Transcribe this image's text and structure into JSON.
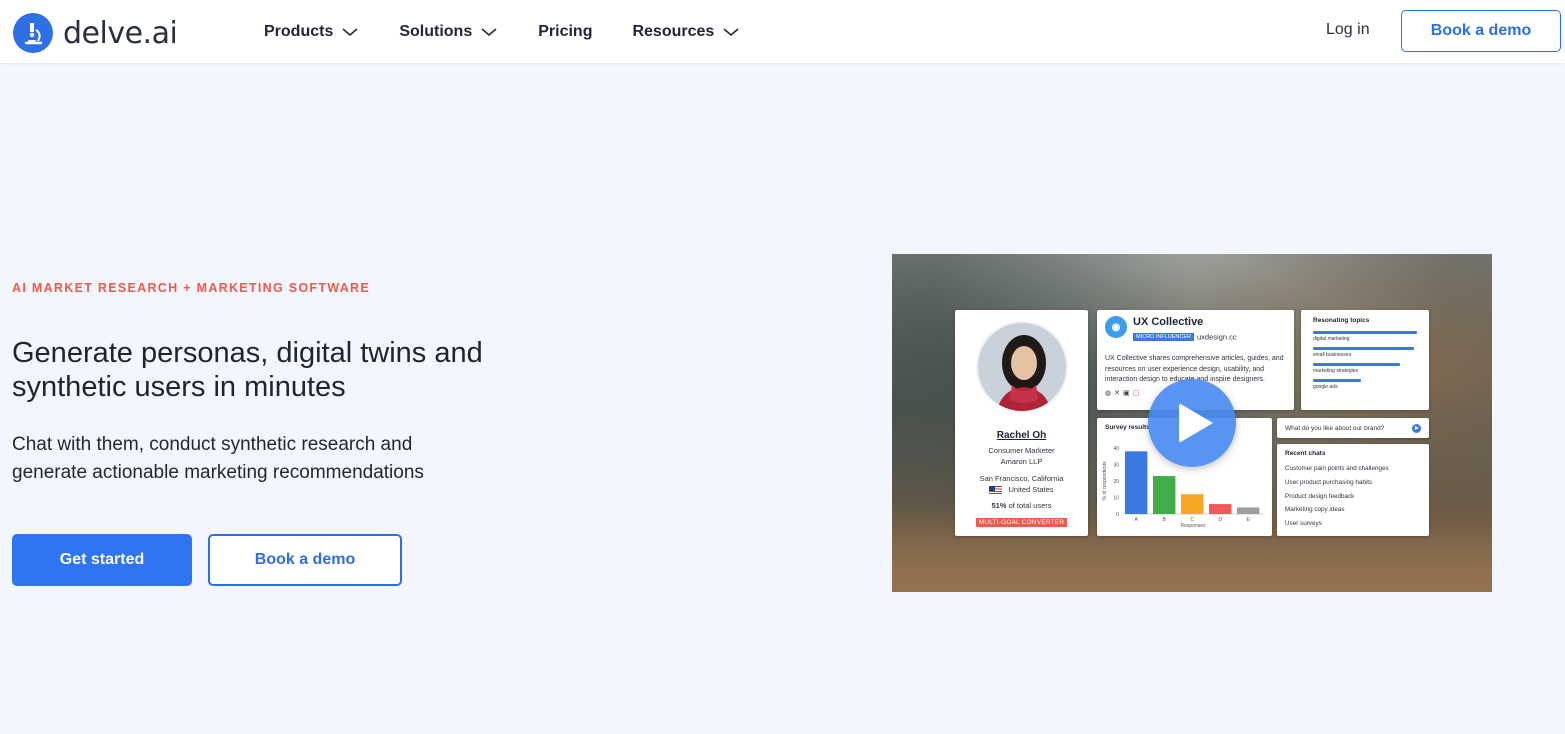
{
  "brand": {
    "name": "delve.ai"
  },
  "nav": {
    "items": [
      {
        "label": "Products",
        "has_dropdown": true
      },
      {
        "label": "Solutions",
        "has_dropdown": true
      },
      {
        "label": "Pricing",
        "has_dropdown": false
      },
      {
        "label": "Resources",
        "has_dropdown": true
      }
    ],
    "login": "Log in",
    "book_demo": "Book a demo"
  },
  "hero": {
    "eyebrow": "AI MARKET RESEARCH + MARKETING SOFTWARE",
    "headline": "Generate personas, digital twins and synthetic users in minutes",
    "subheadline": "Chat with them, conduct synthetic research and generate actionable marketing recommendations",
    "primary_cta": "Get started",
    "secondary_cta": "Book a demo"
  },
  "video": {
    "persona": {
      "name": "Rachel Oh",
      "role": "Consumer Marketer",
      "company": "Amaron LLP",
      "location": "San Francisco, California",
      "country": "United States",
      "share_bold": "51%",
      "share_text": " of total users",
      "badge": "MULTI-GOAL CONVERTER"
    },
    "influencer": {
      "name": "UX Collective",
      "tag": "MICRO INFLUENCER",
      "site": "uxdesign.cc",
      "description": "UX Collective shares comprehensive articles, guides, and resources on user experience design, usability, and interaction design to educate and inspire designers."
    },
    "topics": {
      "title": "Resonating topics",
      "items": [
        {
          "label": "digital marketing",
          "fraction": 1.0
        },
        {
          "label": "small businesses",
          "fraction": 0.97
        },
        {
          "label": "marketing strategies",
          "fraction": 0.84
        },
        {
          "label": "google ads",
          "fraction": 0.46
        }
      ]
    },
    "survey": {
      "title": "Survey results"
    },
    "ask": {
      "placeholder": "What do you like about our brand?"
    },
    "recent_chats": {
      "title": "Recent chats",
      "items": [
        "Customer pain points and challenges",
        "User product purchasing habits",
        "Product design feedback",
        "Marketing copy ideas",
        "User surveys"
      ]
    }
  },
  "chart_data": {
    "type": "bar",
    "categories": [
      "A",
      "B",
      "C",
      "D",
      "E"
    ],
    "values": [
      38,
      23,
      12,
      6,
      4
    ],
    "colors": [
      "#3b7ae0",
      "#3fae49",
      "#f5a623",
      "#f0595a",
      "#9e9e9e"
    ],
    "xlabel": "Responses",
    "ylabel": "% of respondents",
    "ylim": [
      0,
      40
    ],
    "yticks": [
      0,
      10,
      20,
      30,
      40
    ]
  },
  "colors": {
    "accent": "#2f6fe4",
    "eyebrow": "#ef5a4b",
    "background": "#f3f6fc"
  }
}
